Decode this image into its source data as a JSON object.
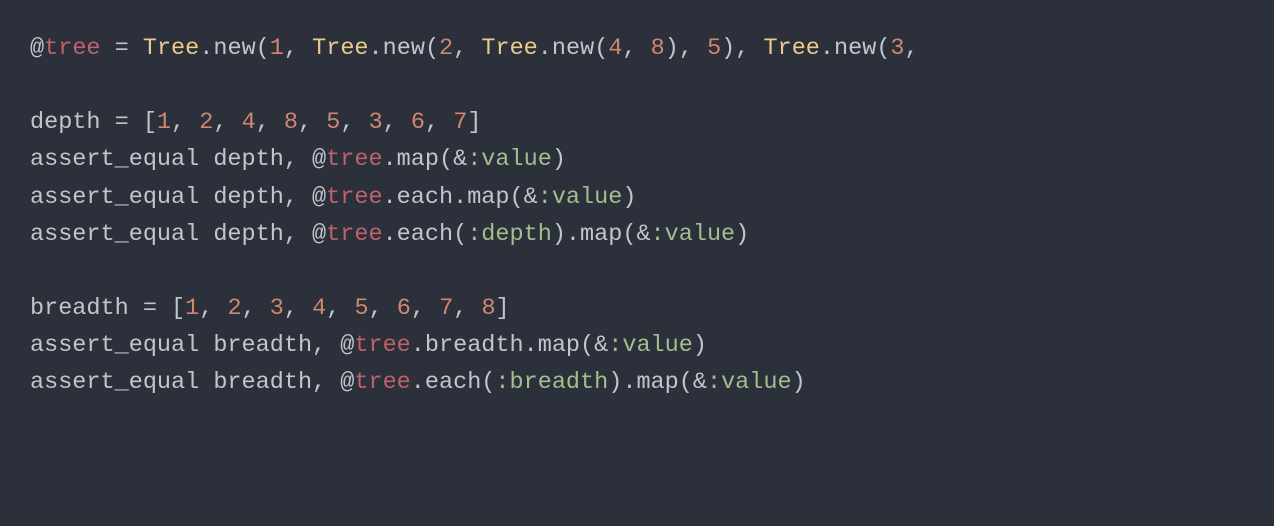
{
  "language": "ruby",
  "theme": "base16-ocean-dark",
  "colors": {
    "background": "#2b303b",
    "default": "#c0c5ce",
    "ivar": "#bf616a",
    "class": "#ebcb8b",
    "number": "#d08770",
    "symbol": "#a3be8c"
  },
  "lines": [
    [
      {
        "c": "at",
        "t": "@"
      },
      {
        "c": "ivar",
        "t": "tree"
      },
      {
        "c": "text",
        "t": " = "
      },
      {
        "c": "class",
        "t": "Tree"
      },
      {
        "c": "text",
        "t": ".new("
      },
      {
        "c": "num",
        "t": "1"
      },
      {
        "c": "text",
        "t": ", "
      },
      {
        "c": "class",
        "t": "Tree"
      },
      {
        "c": "text",
        "t": ".new("
      },
      {
        "c": "num",
        "t": "2"
      },
      {
        "c": "text",
        "t": ", "
      },
      {
        "c": "class",
        "t": "Tree"
      },
      {
        "c": "text",
        "t": ".new("
      },
      {
        "c": "num",
        "t": "4"
      },
      {
        "c": "text",
        "t": ", "
      },
      {
        "c": "num",
        "t": "8"
      },
      {
        "c": "text",
        "t": "), "
      },
      {
        "c": "num",
        "t": "5"
      },
      {
        "c": "text",
        "t": "), "
      },
      {
        "c": "class",
        "t": "Tree"
      },
      {
        "c": "text",
        "t": ".new("
      },
      {
        "c": "num",
        "t": "3"
      },
      {
        "c": "text",
        "t": ", "
      }
    ],
    [],
    [
      {
        "c": "text",
        "t": "depth = ["
      },
      {
        "c": "num",
        "t": "1"
      },
      {
        "c": "text",
        "t": ", "
      },
      {
        "c": "num",
        "t": "2"
      },
      {
        "c": "text",
        "t": ", "
      },
      {
        "c": "num",
        "t": "4"
      },
      {
        "c": "text",
        "t": ", "
      },
      {
        "c": "num",
        "t": "8"
      },
      {
        "c": "text",
        "t": ", "
      },
      {
        "c": "num",
        "t": "5"
      },
      {
        "c": "text",
        "t": ", "
      },
      {
        "c": "num",
        "t": "3"
      },
      {
        "c": "text",
        "t": ", "
      },
      {
        "c": "num",
        "t": "6"
      },
      {
        "c": "text",
        "t": ", "
      },
      {
        "c": "num",
        "t": "7"
      },
      {
        "c": "text",
        "t": "]"
      }
    ],
    [
      {
        "c": "text",
        "t": "assert_equal depth, "
      },
      {
        "c": "at",
        "t": "@"
      },
      {
        "c": "ivar",
        "t": "tree"
      },
      {
        "c": "text",
        "t": ".map(&"
      },
      {
        "c": "sym",
        "t": ":value"
      },
      {
        "c": "text",
        "t": ")"
      }
    ],
    [
      {
        "c": "text",
        "t": "assert_equal depth, "
      },
      {
        "c": "at",
        "t": "@"
      },
      {
        "c": "ivar",
        "t": "tree"
      },
      {
        "c": "text",
        "t": ".each.map(&"
      },
      {
        "c": "sym",
        "t": ":value"
      },
      {
        "c": "text",
        "t": ")"
      }
    ],
    [
      {
        "c": "text",
        "t": "assert_equal depth, "
      },
      {
        "c": "at",
        "t": "@"
      },
      {
        "c": "ivar",
        "t": "tree"
      },
      {
        "c": "text",
        "t": ".each("
      },
      {
        "c": "sym",
        "t": ":depth"
      },
      {
        "c": "text",
        "t": ").map(&"
      },
      {
        "c": "sym",
        "t": ":value"
      },
      {
        "c": "text",
        "t": ")"
      }
    ],
    [],
    [
      {
        "c": "text",
        "t": "breadth = ["
      },
      {
        "c": "num",
        "t": "1"
      },
      {
        "c": "text",
        "t": ", "
      },
      {
        "c": "num",
        "t": "2"
      },
      {
        "c": "text",
        "t": ", "
      },
      {
        "c": "num",
        "t": "3"
      },
      {
        "c": "text",
        "t": ", "
      },
      {
        "c": "num",
        "t": "4"
      },
      {
        "c": "text",
        "t": ", "
      },
      {
        "c": "num",
        "t": "5"
      },
      {
        "c": "text",
        "t": ", "
      },
      {
        "c": "num",
        "t": "6"
      },
      {
        "c": "text",
        "t": ", "
      },
      {
        "c": "num",
        "t": "7"
      },
      {
        "c": "text",
        "t": ", "
      },
      {
        "c": "num",
        "t": "8"
      },
      {
        "c": "text",
        "t": "]"
      }
    ],
    [
      {
        "c": "text",
        "t": "assert_equal breadth, "
      },
      {
        "c": "at",
        "t": "@"
      },
      {
        "c": "ivar",
        "t": "tree"
      },
      {
        "c": "text",
        "t": ".breadth.map(&"
      },
      {
        "c": "sym",
        "t": ":value"
      },
      {
        "c": "text",
        "t": ")"
      }
    ],
    [
      {
        "c": "text",
        "t": "assert_equal breadth, "
      },
      {
        "c": "at",
        "t": "@"
      },
      {
        "c": "ivar",
        "t": "tree"
      },
      {
        "c": "text",
        "t": ".each("
      },
      {
        "c": "sym",
        "t": ":breadth"
      },
      {
        "c": "text",
        "t": ").map(&"
      },
      {
        "c": "sym",
        "t": ":value"
      },
      {
        "c": "text",
        "t": ")"
      }
    ]
  ]
}
